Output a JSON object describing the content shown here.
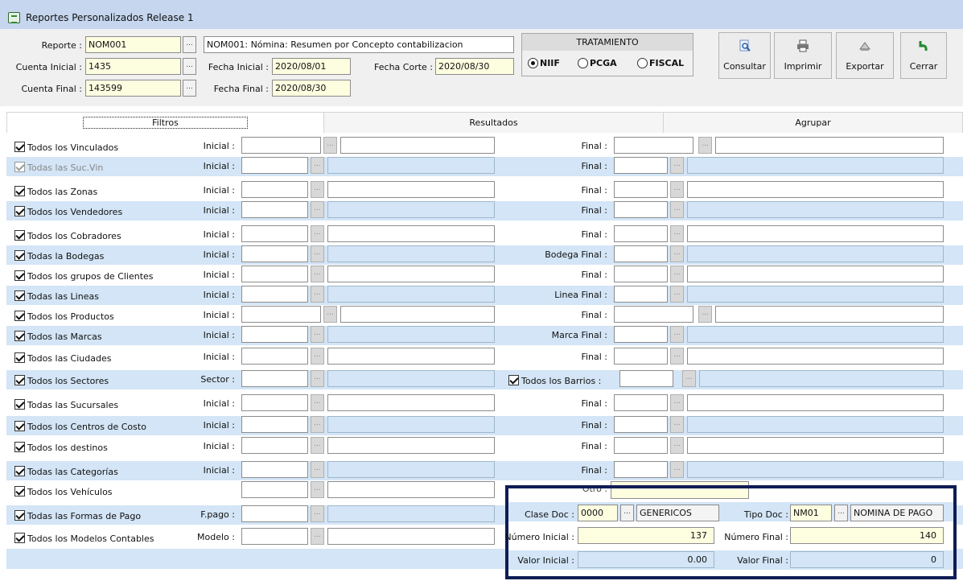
{
  "window": {
    "title": "Reportes Personalizados Release 1"
  },
  "header": {
    "reporte_label": "Reporte :",
    "reporte_code": "NOM001",
    "reporte_desc": "NOM001:  Nómina: Resumen por Concepto contabilizacion",
    "cuenta_inicial_label": "Cuenta Inicial :",
    "cuenta_inicial": "1435",
    "cuenta_final_label": "Cuenta Final :",
    "cuenta_final": "143599",
    "fecha_inicial_label": "Fecha Inicial :",
    "fecha_inicial": "2020/08/01",
    "fecha_final_label": "Fecha Final :",
    "fecha_final": "2020/08/30",
    "fecha_corte_label": "Fecha Corte :",
    "fecha_corte": "2020/08/30",
    "dots": "..."
  },
  "tratamiento": {
    "title": "TRATAMIENTO",
    "options": [
      "NIIF",
      "PCGA",
      "FISCAL"
    ],
    "selected": "NIIF"
  },
  "toolbar": {
    "consultar": "Consultar",
    "imprimir": "Imprimir",
    "exportar": "Exportar",
    "cerrar": "Cerrar"
  },
  "tabs": [
    "Filtros",
    "Resultados",
    "Agrupar"
  ],
  "filters": [
    {
      "label": "Todos los Vinculados",
      "field": "Inicial :",
      "final": "Final :",
      "checked": true,
      "enabled": true
    },
    {
      "label": "Todas las Suc.Vin",
      "field": "Inicial :",
      "final": "Final :",
      "checked": true,
      "enabled": false
    },
    {
      "label": "Todos las Zonas",
      "field": "Inicial :",
      "final": "Final :",
      "checked": true,
      "enabled": true
    },
    {
      "label": "Todos los Vendedores",
      "field": "Inicial :",
      "final": "Final :",
      "checked": true,
      "enabled": true
    },
    {
      "label": "Todos los Cobradores",
      "field": "Inicial :",
      "final": "Final :",
      "checked": true,
      "enabled": true
    },
    {
      "label": "Todas la Bodegas",
      "field": "Inicial :",
      "final": "Bodega Final :",
      "checked": true,
      "enabled": true
    },
    {
      "label": "Todos los grupos de Clientes",
      "field": "Inicial :",
      "final": "Final :",
      "checked": true,
      "enabled": true
    },
    {
      "label": "Todas las Lineas",
      "field": "Inicial :",
      "final": "Linea Final :",
      "checked": true,
      "enabled": true
    },
    {
      "label": "Todos los Productos",
      "field": "Inicial :",
      "final": "Final :",
      "checked": true,
      "enabled": true
    },
    {
      "label": "Todos las Marcas",
      "field": "Inicial :",
      "final": "Marca Final :",
      "checked": true,
      "enabled": true
    },
    {
      "label": "Todos las Ciudades",
      "field": "Inicial :",
      "final": "Final :",
      "checked": true,
      "enabled": true
    },
    {
      "label": "Todos los Sectores",
      "field": "Sector :",
      "final": "Todos los Barrios :",
      "checked": true,
      "enabled": true
    },
    {
      "label": "Todas las Sucursales",
      "field": "Inicial :",
      "final": "Final :",
      "checked": true,
      "enabled": true
    },
    {
      "label": "Todos los Centros de Costo",
      "field": "Inicial :",
      "final": "Final :",
      "checked": true,
      "enabled": true
    },
    {
      "label": "Todos los destinos",
      "field": "Inicial :",
      "final": "Final :",
      "checked": true,
      "enabled": true
    },
    {
      "label": "Todas las Categorías",
      "field": "Inicial :",
      "final": "Final :",
      "checked": true,
      "enabled": true
    },
    {
      "label": "Todos los Vehículos",
      "field": "",
      "final": "Otro :",
      "checked": true,
      "enabled": true
    },
    {
      "label": "Todas las Formas de Pago",
      "field": "F.pago :",
      "final": "",
      "checked": true,
      "enabled": true
    },
    {
      "label": "Todos los Modelos Contables",
      "field": "Modelo :",
      "final": "",
      "checked": true,
      "enabled": true
    }
  ],
  "doc": {
    "clase_doc_label": "Clase Doc :",
    "clase_doc_code": "0000",
    "clase_doc_name": "GENERICOS",
    "tipo_doc_label": "Tipo Doc :",
    "tipo_doc_code": "NM01",
    "tipo_doc_name": "NOMINA DE PAGO",
    "numero_inicial_label": "Número Inicial :",
    "numero_inicial": "137",
    "numero_final_label": "Número Final :",
    "numero_final": "140",
    "valor_inicial_label": "Valor Inicial :",
    "valor_inicial": "0.00",
    "valor_final_label": "Valor Final :",
    "valor_final": "0"
  },
  "colors": {
    "titlebar": "#c5d6ee",
    "band": "#d3e5f6",
    "yellow_field": "#fdfde0",
    "overlay_border": "#0f1c55"
  }
}
